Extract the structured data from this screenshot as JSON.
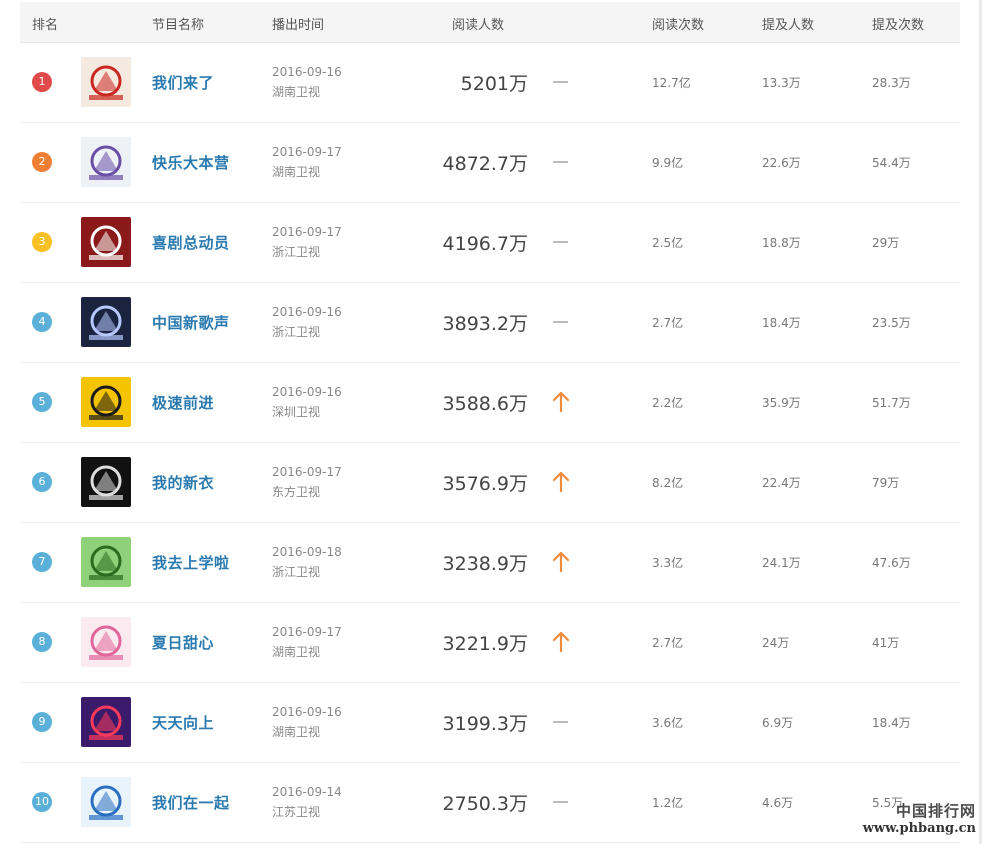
{
  "header": {
    "rank": "排名",
    "program": "节目名称",
    "airtime": "播出时间",
    "readers": "阅读人数",
    "reads": "阅读次数",
    "mentioners": "提及人数",
    "mentions": "提及次数"
  },
  "colors": {
    "rank1": "#e04a4a",
    "rank2": "#f07f36",
    "rank3": "#f8c023",
    "rank_other": "#5ab0d8",
    "trend_up": "#f08a3c",
    "trend_flat": "#bbbbbb",
    "name": "#2a7ab0"
  },
  "rows": [
    {
      "rank": "1",
      "name": "我们来了",
      "date": "2016-09-16",
      "channel": "湖南卫视",
      "readers": "5201万",
      "trend": "flat",
      "reads": "12.7亿",
      "mentioners": "13.3万",
      "mentions": "28.3万",
      "thumb_icon": "show-poster-icon",
      "thumb_bg": "#f6e9e0",
      "thumb_fg": "#c8281f"
    },
    {
      "rank": "2",
      "name": "快乐大本营",
      "date": "2016-09-17",
      "channel": "湖南卫视",
      "readers": "4872.7万",
      "trend": "flat",
      "reads": "9.9亿",
      "mentioners": "22.6万",
      "mentions": "54.4万",
      "thumb_icon": "show-poster-icon",
      "thumb_bg": "#eef1f6",
      "thumb_fg": "#6a4fa6"
    },
    {
      "rank": "3",
      "name": "喜剧总动员",
      "date": "2016-09-17",
      "channel": "浙江卫视",
      "readers": "4196.7万",
      "trend": "flat",
      "reads": "2.5亿",
      "mentioners": "18.8万",
      "mentions": "29万",
      "thumb_icon": "show-poster-icon",
      "thumb_bg": "#8a1a1a",
      "thumb_fg": "#ffffff"
    },
    {
      "rank": "4",
      "name": "中国新歌声",
      "date": "2016-09-16",
      "channel": "浙江卫视",
      "readers": "3893.2万",
      "trend": "flat",
      "reads": "2.7亿",
      "mentioners": "18.4万",
      "mentions": "23.5万",
      "thumb_icon": "show-poster-icon",
      "thumb_bg": "#1a2440",
      "thumb_fg": "#b8c8ff"
    },
    {
      "rank": "5",
      "name": "极速前进",
      "date": "2016-09-16",
      "channel": "深圳卫视",
      "readers": "3588.6万",
      "trend": "up",
      "reads": "2.2亿",
      "mentioners": "35.9万",
      "mentions": "51.7万",
      "thumb_icon": "show-poster-icon",
      "thumb_bg": "#f5c400",
      "thumb_fg": "#1a1a1a"
    },
    {
      "rank": "6",
      "name": "我的新衣",
      "date": "2016-09-17",
      "channel": "东方卫视",
      "readers": "3576.9万",
      "trend": "up",
      "reads": "8.2亿",
      "mentioners": "22.4万",
      "mentions": "79万",
      "thumb_icon": "show-poster-icon",
      "thumb_bg": "#111111",
      "thumb_fg": "#dddddd"
    },
    {
      "rank": "7",
      "name": "我去上学啦",
      "date": "2016-09-18",
      "channel": "浙江卫视",
      "readers": "3238.9万",
      "trend": "up",
      "reads": "3.3亿",
      "mentioners": "24.1万",
      "mentions": "47.6万",
      "thumb_icon": "show-poster-icon",
      "thumb_bg": "#8fd07a",
      "thumb_fg": "#2c6b1e"
    },
    {
      "rank": "8",
      "name": "夏日甜心",
      "date": "2016-09-17",
      "channel": "湖南卫视",
      "readers": "3221.9万",
      "trend": "up",
      "reads": "2.7亿",
      "mentioners": "24万",
      "mentions": "41万",
      "thumb_icon": "show-poster-icon",
      "thumb_bg": "#fbeaf0",
      "thumb_fg": "#e0669a"
    },
    {
      "rank": "9",
      "name": "天天向上",
      "date": "2016-09-16",
      "channel": "湖南卫视",
      "readers": "3199.3万",
      "trend": "flat",
      "reads": "3.6亿",
      "mentioners": "6.9万",
      "mentions": "18.4万",
      "thumb_icon": "show-poster-icon",
      "thumb_bg": "#3a1a6a",
      "thumb_fg": "#ff3a5a"
    },
    {
      "rank": "10",
      "name": "我们在一起",
      "date": "2016-09-14",
      "channel": "江苏卫视",
      "readers": "2750.3万",
      "trend": "flat",
      "reads": "1.2亿",
      "mentioners": "4.6万",
      "mentions": "5.5万",
      "thumb_icon": "show-poster-icon",
      "thumb_bg": "#e8f3fb",
      "thumb_fg": "#2a6fc0"
    }
  ],
  "watermark": {
    "line1": "中国排行网",
    "line2": "www.phbang.cn"
  }
}
